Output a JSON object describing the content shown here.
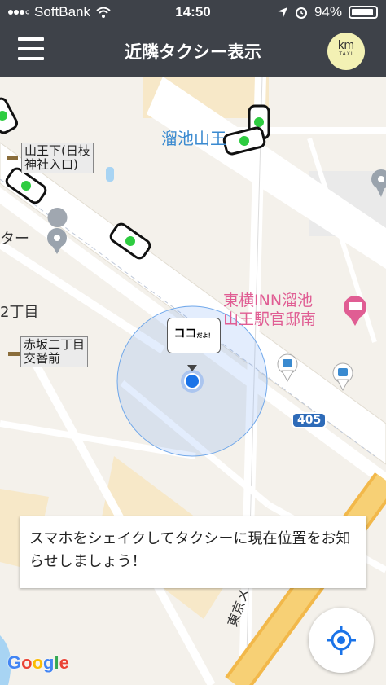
{
  "status_bar": {
    "carrier": "SoftBank",
    "time": "14:50",
    "battery": "94%",
    "battery_level": 0.94
  },
  "nav": {
    "title": "近隣タクシー表示",
    "logo_text": "km",
    "logo_sub": "TAXI"
  },
  "map": {
    "labels": {
      "tameike_sanno": "溜池山王",
      "stop_sanno": [
        "山王下(日枝",
        "神社入口)"
      ],
      "stop_akasaka": [
        "赤坂二丁目",
        "交番前"
      ],
      "partial_center": "ター",
      "partial_chome": "2丁目",
      "hotel": [
        "東横INN溜池",
        "山王駅官邸南"
      ],
      "route": "405",
      "metro": "東京メト"
    },
    "marker_bubble": {
      "main": "ココ",
      "small": "だよ！"
    }
  },
  "notice": "スマホをシェイクしてタクシーに現在位置をお知らせしましょう！",
  "google": [
    "G",
    "o",
    "o",
    "g",
    "l",
    "e"
  ],
  "colors": {
    "bar": "#3e4249",
    "accent_blue": "#1a73e8",
    "poi_pink": "#e05d93"
  }
}
